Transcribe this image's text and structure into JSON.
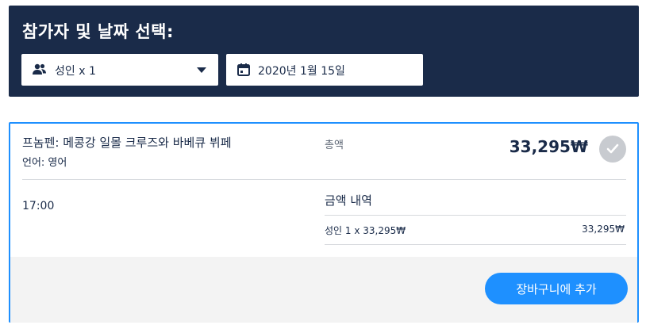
{
  "header": {
    "title": "참가자 및 날짜 선택:",
    "participants": {
      "icon": "users-icon",
      "value": "성인 x 1"
    },
    "date": {
      "icon": "calendar-icon",
      "value": "2020년 1월 15일"
    },
    "background": "#1a2b49"
  },
  "option": {
    "title": "프놈펜: 메콩강 일몰 크루즈와 바베큐 뷔페",
    "language": "언어: 영어",
    "total_label": "총액",
    "total_price": "33,295₩",
    "selected_icon": "check-circle-icon",
    "time": "17:00",
    "breakdown": {
      "title": "금액 내역",
      "line_label": "성인  1 x 33,295₩",
      "line_total": "33,295₩"
    },
    "add_to_cart": "장바구니에 추가",
    "accent": "#1e90ff"
  }
}
